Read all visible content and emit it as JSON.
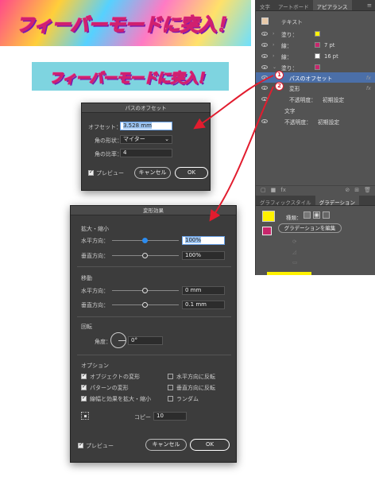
{
  "banner": {
    "text": "フィーバーモードに突入！"
  },
  "panel": {
    "tabs": [
      "文字",
      "アートボード",
      "アピアランス"
    ],
    "menu_icon": "≡",
    "text_label": "テキスト",
    "rows": [
      {
        "label": "塗り：",
        "swatch": "#fff200"
      },
      {
        "label": "線：",
        "value": "7 pt",
        "swatch": "#c8266c"
      },
      {
        "label": "線：",
        "value": "16 pt",
        "swatch": "#ffffff"
      },
      {
        "label": "塗り：",
        "swatch": "#c8266c"
      }
    ],
    "path_offset": "パスのオフセット",
    "transform": "変形",
    "opacity_label": "不透明度：",
    "opacity_value": "初期設定",
    "text_word": "文字",
    "fx": "fx",
    "tabs2": [
      "グラフィックスタイル",
      "グラデーション"
    ],
    "kind_label": "種類：",
    "edit_gradient": "グラデーションを編集",
    "badges": [
      "1",
      "2"
    ],
    "accent": "#e21c2e"
  },
  "offset_dialog": {
    "title": "パスのオフセット",
    "offset_label": "オフセット：",
    "offset_value": "3.528 mm",
    "join_label": "角の形状：",
    "join_value": "マイター",
    "miter_label": "角の比率：",
    "miter_value": "4",
    "preview": "プレビュー",
    "cancel": "キャンセル",
    "ok": "OK"
  },
  "transform_dialog": {
    "title": "変形効果",
    "scale_section": "拡大・縮小",
    "h_label": "水平方向：",
    "h_value": "100%",
    "v_label": "垂直方向：",
    "v_value": "100%",
    "move_section": "移動",
    "mh_label": "水平方向：",
    "mh_value": "0 mm",
    "mv_label": "垂直方向：",
    "mv_value": "0.1 mm",
    "rotate_section": "回転",
    "angle_label": "角度：",
    "angle_value": "0°",
    "options_section": "オプション",
    "opt_transform_objects": "オブジェクトの変形",
    "opt_transform_patterns": "パターンの変形",
    "opt_scale_strokes": "線幅と効果を拡大・縮小",
    "opt_reflect_x": "水平方向に反転",
    "opt_reflect_y": "垂直方向に反転",
    "opt_random": "ランダム",
    "copies_label": "コピー",
    "copies_value": "10",
    "preview": "プレビュー",
    "cancel": "キャンセル",
    "ok": "OK"
  }
}
